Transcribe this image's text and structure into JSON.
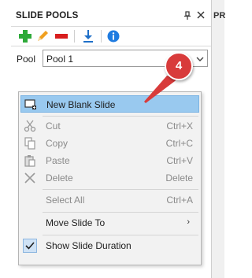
{
  "panel": {
    "title": "SLIDE POOLS",
    "pin_glyph": "📌",
    "close_glyph": "✕",
    "right_tab_label": "PR"
  },
  "toolbar": {
    "buttons": [
      {
        "icon": "add-icon",
        "color": "#2eaa3a"
      },
      {
        "icon": "edit-pencil-icon",
        "color": "#f0a020"
      },
      {
        "icon": "remove-icon",
        "color": "#d81e1e"
      },
      {
        "icon": "download-icon",
        "color": "#1f6fc8"
      },
      {
        "icon": "info-icon",
        "color": "#1f7be0"
      }
    ]
  },
  "pool": {
    "label": "Pool",
    "selected": "Pool 1"
  },
  "context_menu": {
    "items": {
      "new_blank_slide": {
        "label": "New Blank Slide",
        "shortcut": ""
      },
      "cut": {
        "label": "Cut",
        "shortcut": "Ctrl+X"
      },
      "copy": {
        "label": "Copy",
        "shortcut": "Ctrl+C"
      },
      "paste": {
        "label": "Paste",
        "shortcut": "Ctrl+V"
      },
      "delete": {
        "label": "Delete",
        "shortcut": "Delete"
      },
      "select_all": {
        "label": "Select All",
        "shortcut": "Ctrl+A"
      },
      "move_slide_to": {
        "label": "Move Slide To",
        "submenu_glyph": "›"
      },
      "show_slide_duration": {
        "label": "Show Slide Duration",
        "checked": true
      }
    },
    "highlight_color": "#99c9ef"
  },
  "callout": {
    "number": "4",
    "color": "#d83b3b"
  }
}
